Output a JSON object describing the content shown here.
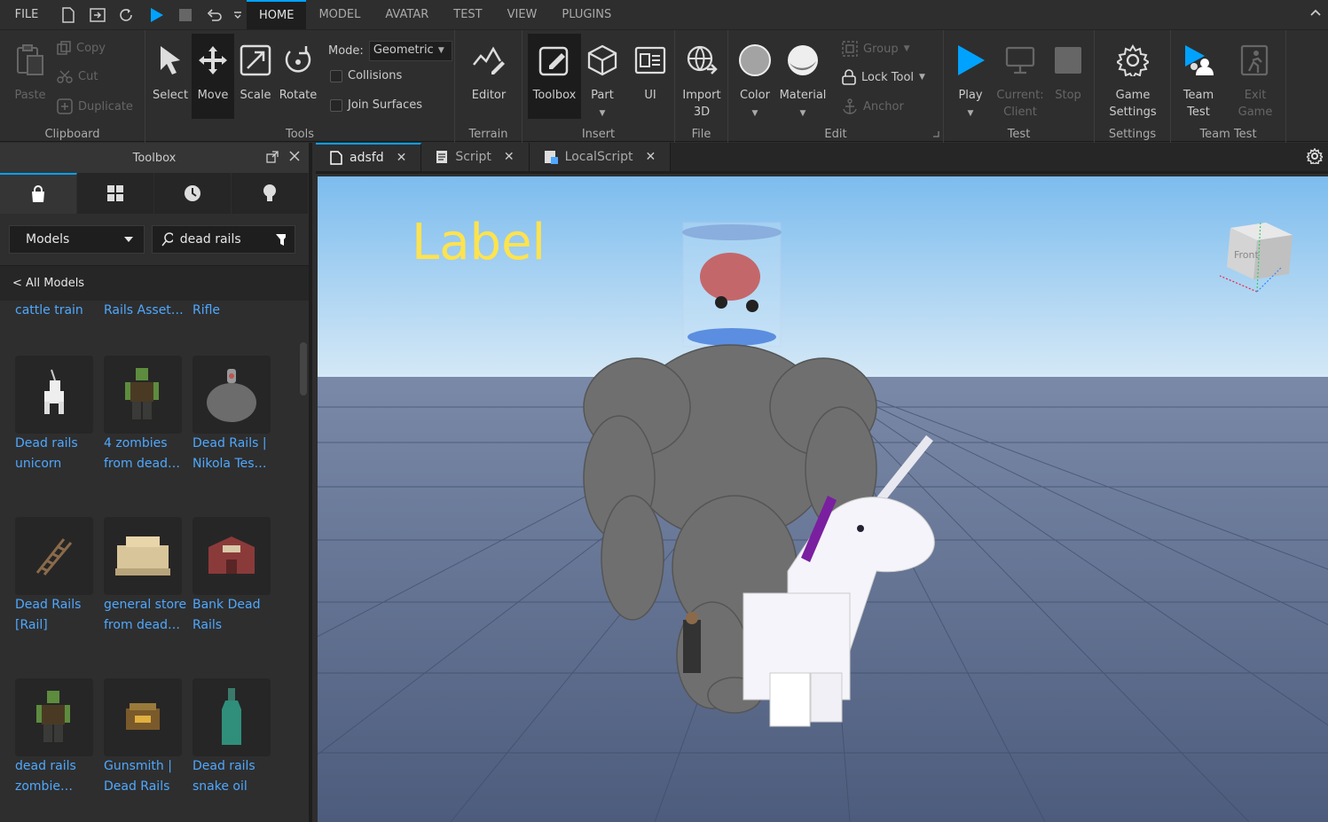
{
  "menubar": {
    "file": "FILE",
    "tabs": [
      {
        "label": "HOME",
        "active": true
      },
      {
        "label": "MODEL",
        "active": false
      },
      {
        "label": "AVATAR",
        "active": false
      },
      {
        "label": "TEST",
        "active": false
      },
      {
        "label": "VIEW",
        "active": false
      },
      {
        "label": "PLUGINS",
        "active": false
      }
    ]
  },
  "ribbon": {
    "clipboard": {
      "label": "Clipboard",
      "paste": "Paste",
      "copy": "Copy",
      "cut": "Cut",
      "duplicate": "Duplicate"
    },
    "tools": {
      "label": "Tools",
      "select": "Select",
      "move": "Move",
      "scale": "Scale",
      "rotate": "Rotate",
      "mode_label": "Mode:",
      "mode_value": "Geometric",
      "collisions": "Collisions",
      "join_surfaces": "Join Surfaces"
    },
    "terrain": {
      "label": "Terrain",
      "editor": "Editor"
    },
    "insert": {
      "label": "Insert",
      "toolbox": "Toolbox",
      "part": "Part",
      "ui": "UI"
    },
    "file": {
      "label": "File",
      "import": "Import",
      "import2": "3D"
    },
    "edit": {
      "label": "Edit",
      "color": "Color",
      "material": "Material",
      "group": "Group",
      "lock_tool": "Lock Tool",
      "anchor": "Anchor"
    },
    "test": {
      "label": "Test",
      "play": "Play",
      "current": "Current:",
      "client": "Client",
      "stop": "Stop"
    },
    "settings": {
      "label": "Settings",
      "game": "Game",
      "settings": "Settings"
    },
    "team_test": {
      "label": "Team Test",
      "team": "Team",
      "test": "Test",
      "exit": "Exit",
      "game": "Game"
    }
  },
  "toolbox": {
    "title": "Toolbox",
    "category": "Models",
    "search_value": "dead rails",
    "breadcrumb": "< All Models",
    "top_row": [
      "cattle train",
      "Rails Asset…",
      "Rifle"
    ],
    "items": [
      {
        "name": "Dead rails\nunicorn",
        "icon": "unicorn-thumb"
      },
      {
        "name": "4 zombies\nfrom dead…",
        "icon": "zombie-thumb"
      },
      {
        "name": "Dead Rails |\nNikola Tes…",
        "icon": "monster-thumb"
      },
      {
        "name": "Dead Rails\n[Rail]",
        "icon": "rail-thumb"
      },
      {
        "name": "general store\nfrom dead…",
        "icon": "store-thumb"
      },
      {
        "name": "Bank Dead\nRails",
        "icon": "bank-thumb"
      },
      {
        "name": "dead rails\nzombie…",
        "icon": "zombie-thumb"
      },
      {
        "name": "Gunsmith |\nDead Rails",
        "icon": "gunsmith-thumb"
      },
      {
        "name": "Dead rails\nsnake oil",
        "icon": "bottle-thumb"
      }
    ]
  },
  "doc_tabs": [
    {
      "label": "adsfd",
      "active": true
    },
    {
      "label": "Script",
      "active": false
    },
    {
      "label": "LocalScript",
      "active": false
    }
  ],
  "viewport": {
    "label": "Label",
    "viewcube_front": "Front"
  },
  "colors": {
    "accent": "#00a2ff",
    "link": "#4fa8ff",
    "label_yellow": "#ffe34d"
  }
}
